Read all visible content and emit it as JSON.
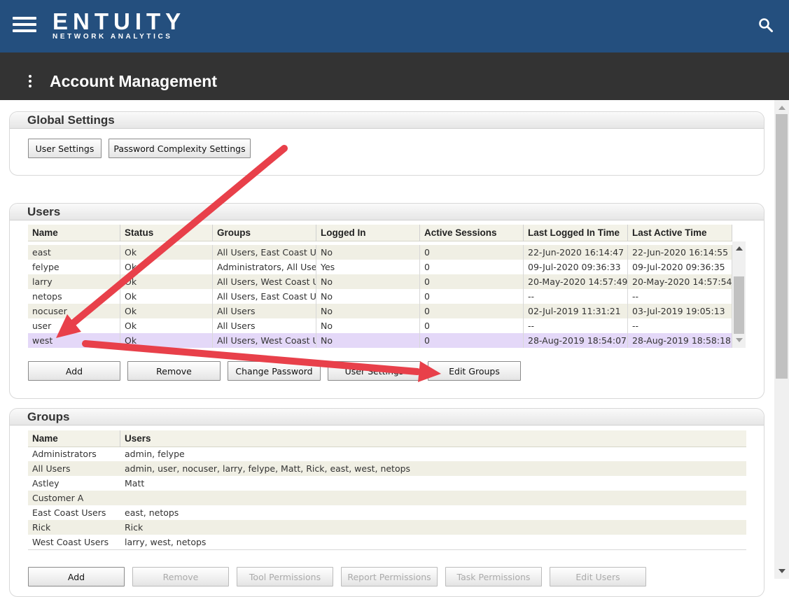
{
  "header": {
    "brand_name": "ENTUITY",
    "brand_sub": "NETWORK ANALYTICS",
    "background": "#244f7e"
  },
  "titlebar": {
    "title": "Account Management"
  },
  "global_settings": {
    "title": "Global Settings",
    "buttons": [
      "User Settings",
      "Password Complexity Settings"
    ]
  },
  "users": {
    "title": "Users",
    "columns": [
      "Name",
      "Status",
      "Groups",
      "Logged In",
      "Active Sessions",
      "Last Logged In Time",
      "Last Active Time"
    ],
    "rows": [
      [
        "east",
        "Ok",
        "All Users, East Coast Users",
        "No",
        "0",
        "22-Jun-2020 16:14:47",
        "22-Jun-2020 16:14:55"
      ],
      [
        "felype",
        "Ok",
        "Administrators, All Users",
        "Yes",
        "0",
        "09-Jul-2020 09:36:33",
        "09-Jul-2020 09:36:35"
      ],
      [
        "larry",
        "Ok",
        "All Users, West Coast Users",
        "No",
        "0",
        "20-May-2020 14:57:49",
        "20-May-2020 14:57:54"
      ],
      [
        "netops",
        "Ok",
        "All Users, East Coast Users",
        "No",
        "0",
        "--",
        "--"
      ],
      [
        "nocuser",
        "Ok",
        "All Users",
        "No",
        "0",
        "02-Jul-2019 11:31:21",
        "03-Jul-2019 19:05:13"
      ],
      [
        "user",
        "Ok",
        "All Users",
        "No",
        "0",
        "--",
        "--"
      ],
      [
        "west",
        "Ok",
        "All Users, West Coast Users",
        "No",
        "0",
        "28-Aug-2019 18:54:07",
        "28-Aug-2019 18:58:18"
      ]
    ],
    "selected_row": "west",
    "buttons": [
      "Add",
      "Remove",
      "Change Password",
      "User Settings",
      "Edit Groups"
    ]
  },
  "groups": {
    "title": "Groups",
    "columns": [
      "Name",
      "Users"
    ],
    "rows": [
      [
        "Administrators",
        "admin, felype"
      ],
      [
        "All Users",
        "admin, user, nocuser, larry, felype, Matt, Rick, east, west, netops"
      ],
      [
        "Astley",
        "Matt"
      ],
      [
        "Customer A",
        ""
      ],
      [
        "East Coast Users",
        "east, netops"
      ],
      [
        "Rick",
        "Rick"
      ],
      [
        "West Coast Users",
        "larry, west, netops"
      ]
    ],
    "buttons": [
      "Add",
      "Remove",
      "Tool Permissions",
      "Report Permissions",
      "Task Permissions",
      "Edit Users"
    ]
  },
  "annotation_color": "#e8404a",
  "icons": [
    "hamburger-menu-icon",
    "search-icon",
    "kebab-menu-icon"
  ]
}
